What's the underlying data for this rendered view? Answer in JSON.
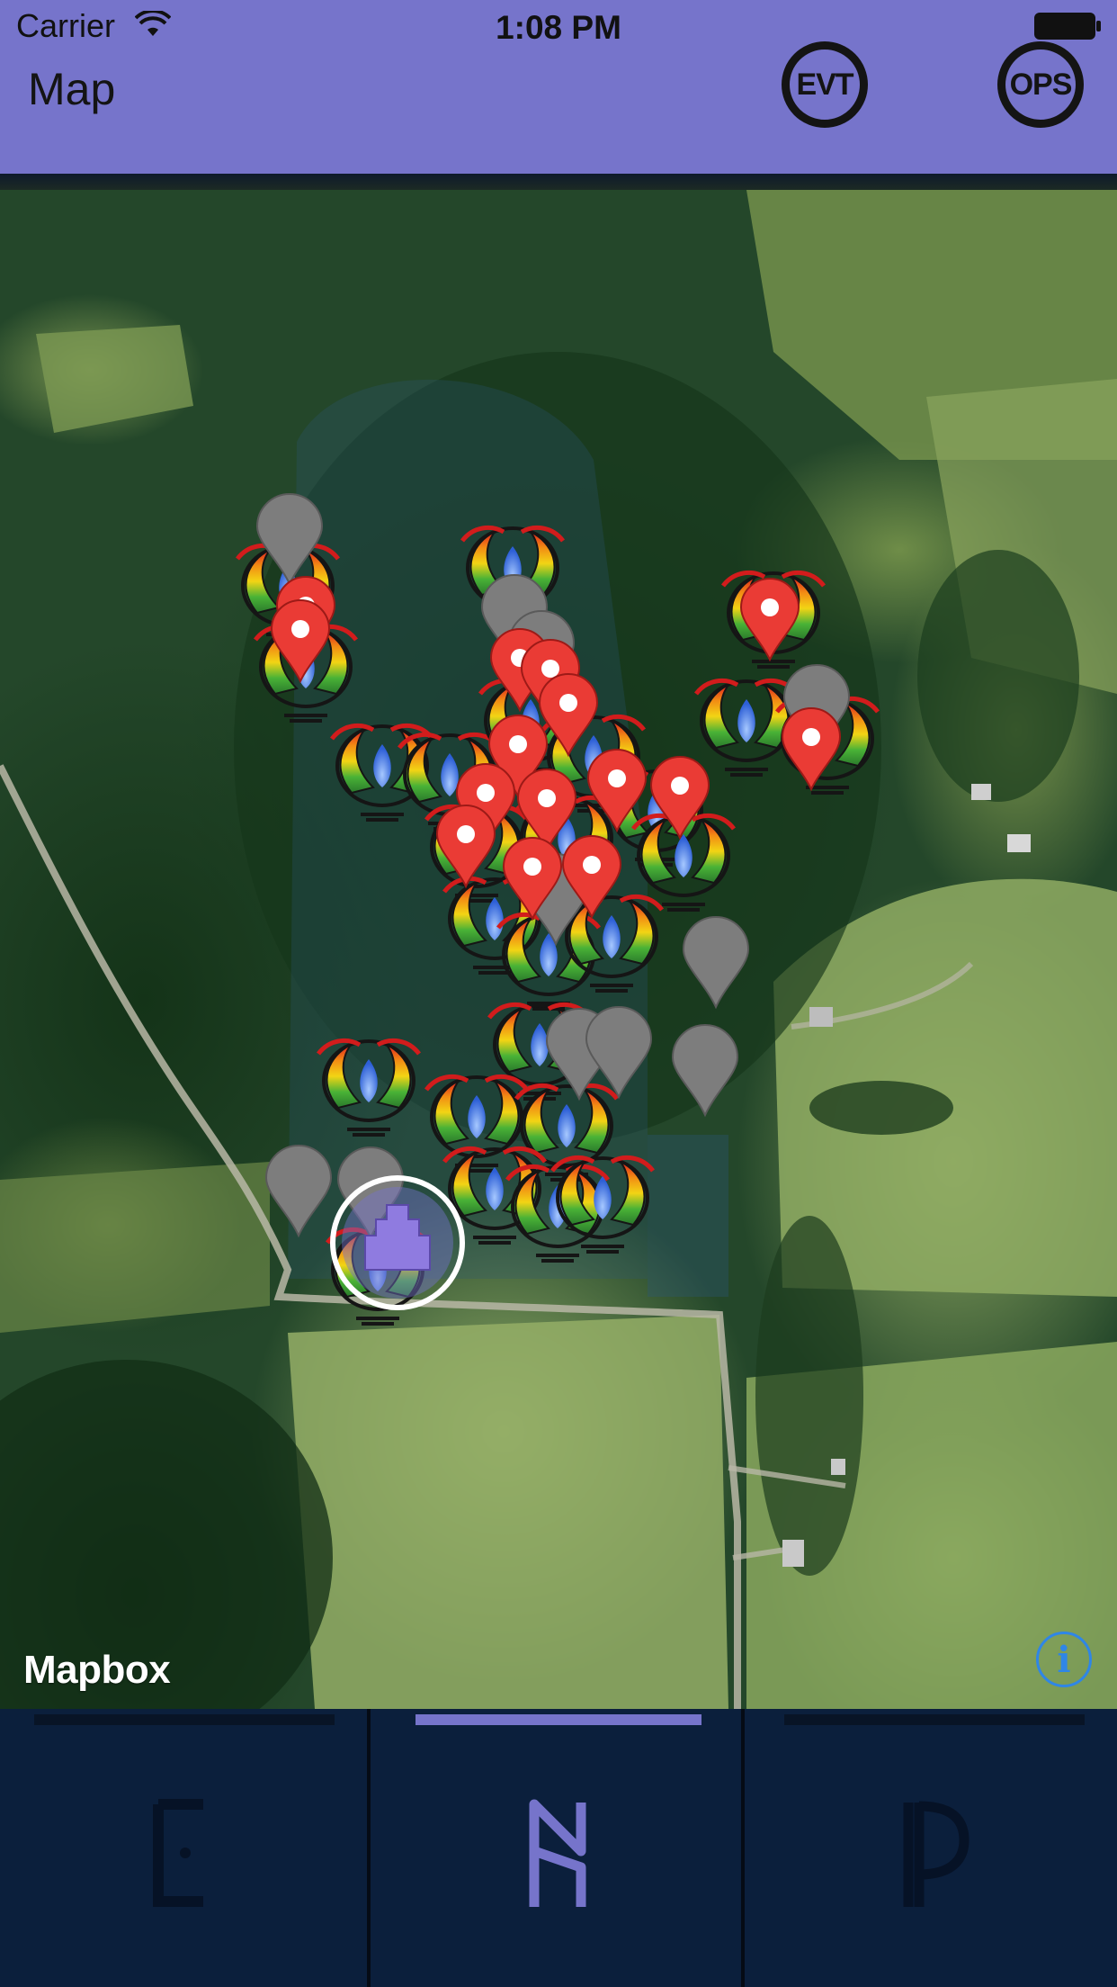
{
  "status_bar": {
    "carrier": "Carrier",
    "time": "1:08 PM",
    "wifi_icon": "wifi-icon",
    "battery_icon": "battery-icon"
  },
  "header": {
    "title": "Map",
    "evt_label": "EVT",
    "ops_label": "OPS",
    "background_color": "#7674cb"
  },
  "map": {
    "attribution_logo": "Mapbox",
    "info_label": "i",
    "info_icon": "info-icon",
    "marker_types": [
      "campfire-icon",
      "red-location-pin-icon",
      "gray-location-pin-icon",
      "user-location-icon"
    ]
  },
  "tabbar": {
    "tabs": [
      {
        "name": "events",
        "icon": "e-rune-icon",
        "active": false
      },
      {
        "name": "map",
        "icon": "m-rune-icon",
        "active": true
      },
      {
        "name": "profile",
        "icon": "p-rune-icon",
        "active": false
      }
    ],
    "active_color": "#7674cb",
    "inactive_color": "#061226"
  }
}
